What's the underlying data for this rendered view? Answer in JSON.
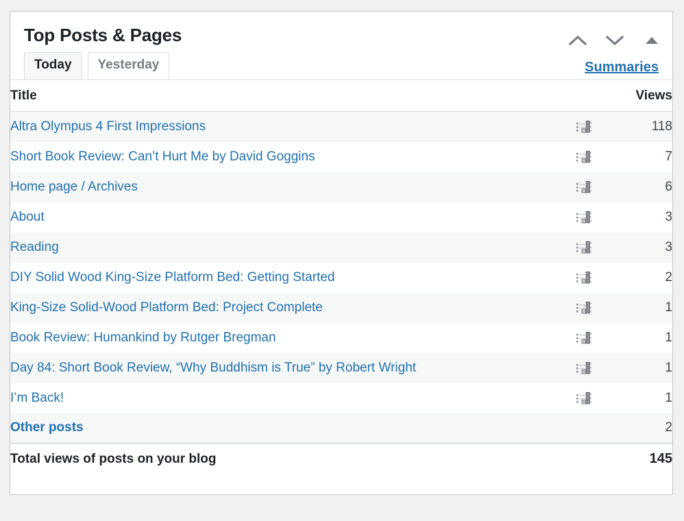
{
  "panel": {
    "title": "Top Posts & Pages",
    "controls": [
      {
        "name": "move-up-icon",
        "label": "Move up"
      },
      {
        "name": "move-down-icon",
        "label": "Move down"
      },
      {
        "name": "toggle-panel-icon",
        "label": "Toggle panel"
      }
    ],
    "tabs": [
      {
        "label": "Today",
        "active": true
      },
      {
        "label": "Yesterday",
        "active": false
      }
    ],
    "summaries_label": "Summaries",
    "columns": {
      "title": "Title",
      "views": "Views"
    },
    "rows": [
      {
        "title": "Altra Olympus 4 First Impressions",
        "views": "118",
        "icon": true
      },
      {
        "title": "Short Book Review: Can’t Hurt Me by David Goggins",
        "views": "7",
        "icon": true
      },
      {
        "title": "Home page / Archives",
        "views": "6",
        "icon": true
      },
      {
        "title": "About",
        "views": "3",
        "icon": true
      },
      {
        "title": "Reading",
        "views": "3",
        "icon": true
      },
      {
        "title": "DIY Solid Wood King-Size Platform Bed: Getting Started",
        "views": "2",
        "icon": true
      },
      {
        "title": "King-Size Solid-Wood Platform Bed: Project Complete",
        "views": "1",
        "icon": true
      },
      {
        "title": "Book Review: Humankind by Rutger Bregman",
        "views": "1",
        "icon": true
      },
      {
        "title": "Day 84: Short Book Review, “Why Buddhism is True” by Robert Wright",
        "views": "1",
        "icon": true
      },
      {
        "title": "I’m Back!",
        "views": "1",
        "icon": true
      },
      {
        "title": "Other posts",
        "views": "2",
        "icon": false,
        "bold": true
      }
    ],
    "total": {
      "label": "Total views of posts on your blog",
      "views": "145"
    },
    "colors": {
      "link": "#2271b1",
      "text": "#1d2327",
      "muted": "#787c82",
      "border": "#c3c4c7",
      "row_alt": "#f6f7f7"
    }
  }
}
